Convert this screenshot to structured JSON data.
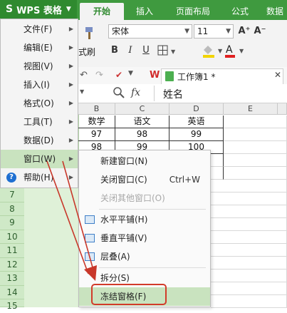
{
  "app": {
    "logo_text": "WPS 表格",
    "logo_glyph": "S",
    "dropdown_glyph": "▼"
  },
  "tabs": [
    {
      "label": "开始",
      "active": true
    },
    {
      "label": "插入"
    },
    {
      "label": "页面布局"
    },
    {
      "label": "公式"
    },
    {
      "label": "数据"
    }
  ],
  "ribbon": {
    "font_name": "宋体",
    "font_size": "11",
    "format_painter_label": "式刷",
    "bold": "B",
    "italic": "I",
    "underline": "U",
    "grow_font": "A⁺",
    "shrink_font": "A⁻"
  },
  "document": {
    "tab_title": "工作簿1 *",
    "wps_glyph": "W"
  },
  "formula_bar": {
    "fx_label": "fx",
    "value": "姓名"
  },
  "columns": [
    "B",
    "C",
    "D",
    "E"
  ],
  "table": {
    "header": [
      "数学",
      "语文",
      "英语"
    ],
    "rows": [
      [
        "97",
        "98",
        "99"
      ],
      [
        "98",
        "99",
        "100"
      ]
    ]
  },
  "row_numbers": [
    "7",
    "8",
    "9",
    "10",
    "11",
    "12",
    "13",
    "14",
    "15"
  ],
  "main_menu": [
    {
      "label": "文件(F)"
    },
    {
      "label": "编辑(E)"
    },
    {
      "label": "视图(V)"
    },
    {
      "label": "插入(I)"
    },
    {
      "label": "格式(O)"
    },
    {
      "label": "工具(T)"
    },
    {
      "label": "数据(D)"
    },
    {
      "label": "窗口(W)",
      "selected": true
    },
    {
      "label": "帮助(H)"
    }
  ],
  "window_menu": [
    {
      "label": "新建窗口(N)"
    },
    {
      "label": "关闭窗口(C)",
      "shortcut": "Ctrl+W"
    },
    {
      "label": "关闭其他窗口(O)",
      "disabled": true
    },
    {
      "label": "水平平铺(H)"
    },
    {
      "label": "垂直平铺(V)"
    },
    {
      "label": "层叠(A)"
    },
    {
      "label": "拆分(S)"
    },
    {
      "label": "冻结窗格(F)",
      "selected": true
    }
  ],
  "colors": {
    "accent": "#3f9a3f",
    "selected": "#c9e3bf",
    "annotation": "#d23b2a"
  }
}
